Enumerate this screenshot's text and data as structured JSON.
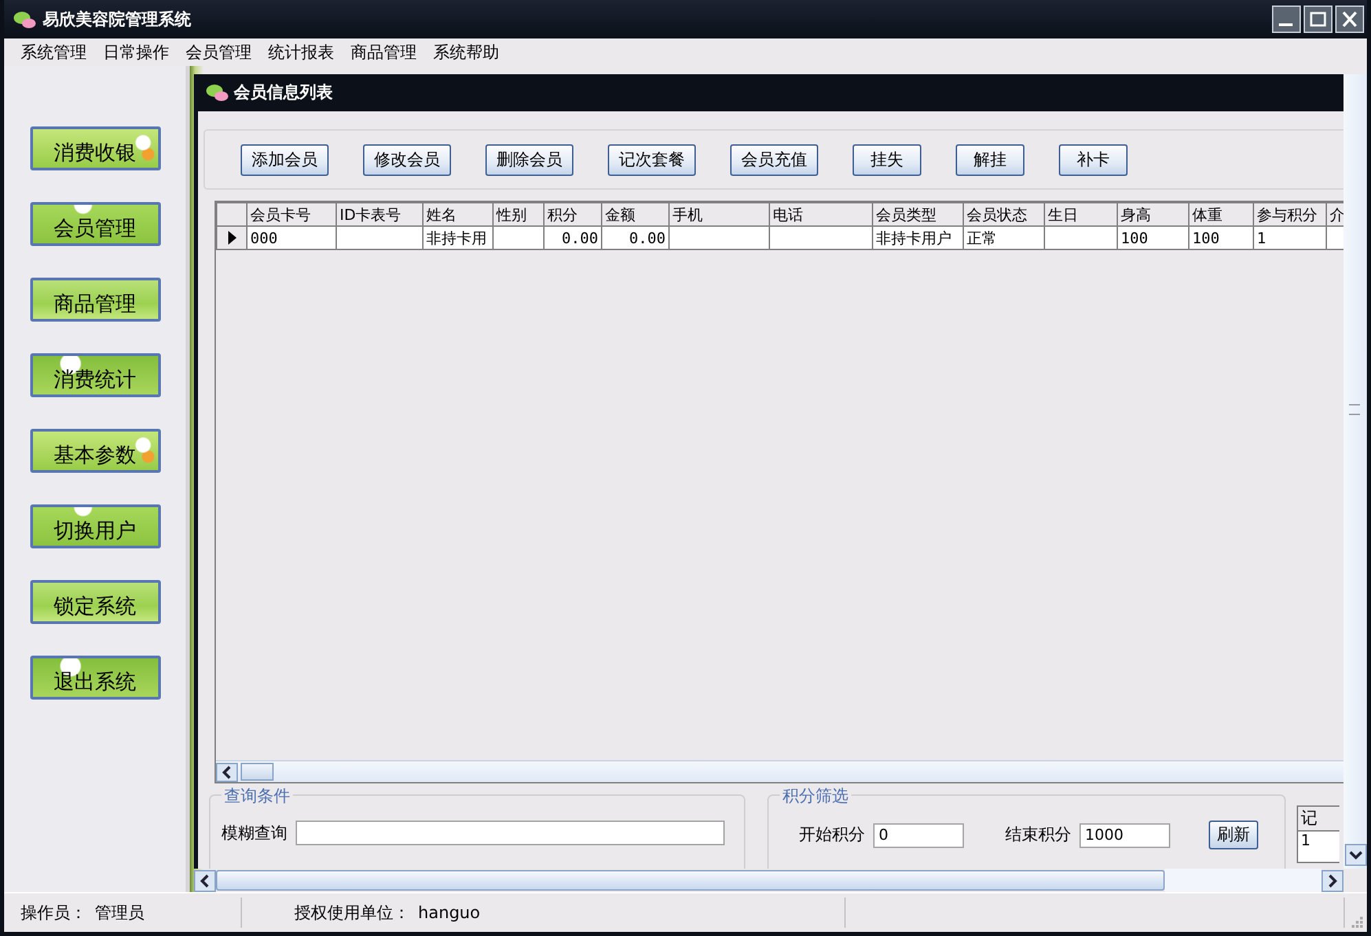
{
  "window": {
    "title": "易欣美容院管理系统"
  },
  "menu": [
    "系统管理",
    "日常操作",
    "会员管理",
    "统计报表",
    "商品管理",
    "系统帮助"
  ],
  "sidebar": {
    "buttons": [
      "消费收银",
      "会员管理",
      "商品管理",
      "消费统计",
      "基本参数",
      "切换用户",
      "锁定系统",
      "退出系统"
    ]
  },
  "child_window": {
    "title": "会员信息列表",
    "toolbar": [
      "添加会员",
      "修改会员",
      "删除会员",
      "记次套餐",
      "会员充值",
      "挂失",
      "解挂",
      "补卡"
    ],
    "table": {
      "columns": [
        {
          "label": "会员卡号",
          "kind": "text"
        },
        {
          "label": "ID卡表号",
          "kind": "text"
        },
        {
          "label": "姓名",
          "kind": "text"
        },
        {
          "label": "性别",
          "kind": "text"
        },
        {
          "label": "积分",
          "kind": "number"
        },
        {
          "label": "金额",
          "kind": "number"
        },
        {
          "label": "手机",
          "kind": "text"
        },
        {
          "label": "电话",
          "kind": "text"
        },
        {
          "label": "会员类型",
          "kind": "text"
        },
        {
          "label": "会员状态",
          "kind": "text"
        },
        {
          "label": "生日",
          "kind": "text"
        },
        {
          "label": "身高",
          "kind": "text"
        },
        {
          "label": "体重",
          "kind": "text"
        },
        {
          "label": "参与积分",
          "kind": "text"
        },
        {
          "label": "介",
          "kind": "text"
        }
      ],
      "rows": [
        {
          "selected": true,
          "cells": [
            "000",
            "",
            "非持卡用",
            "",
            "0.00",
            "0.00",
            "",
            "",
            "非持卡用户",
            "正常",
            "",
            "100",
            "100",
            "1",
            ""
          ]
        }
      ]
    },
    "query": {
      "legend": "查询条件",
      "fuzzy_label": "模糊查询"
    },
    "score_filter": {
      "legend": "积分筛选",
      "start_label": "开始积分",
      "start_value": "0",
      "end_label": "结束积分",
      "end_value": "1000",
      "refresh": "刷新"
    },
    "records": {
      "label": "记",
      "value": "1"
    }
  },
  "status_bar": [
    {
      "label": "操作员：",
      "value": "管理员"
    },
    {
      "label": "授权使用单位：",
      "value": "hanguo"
    }
  ]
}
